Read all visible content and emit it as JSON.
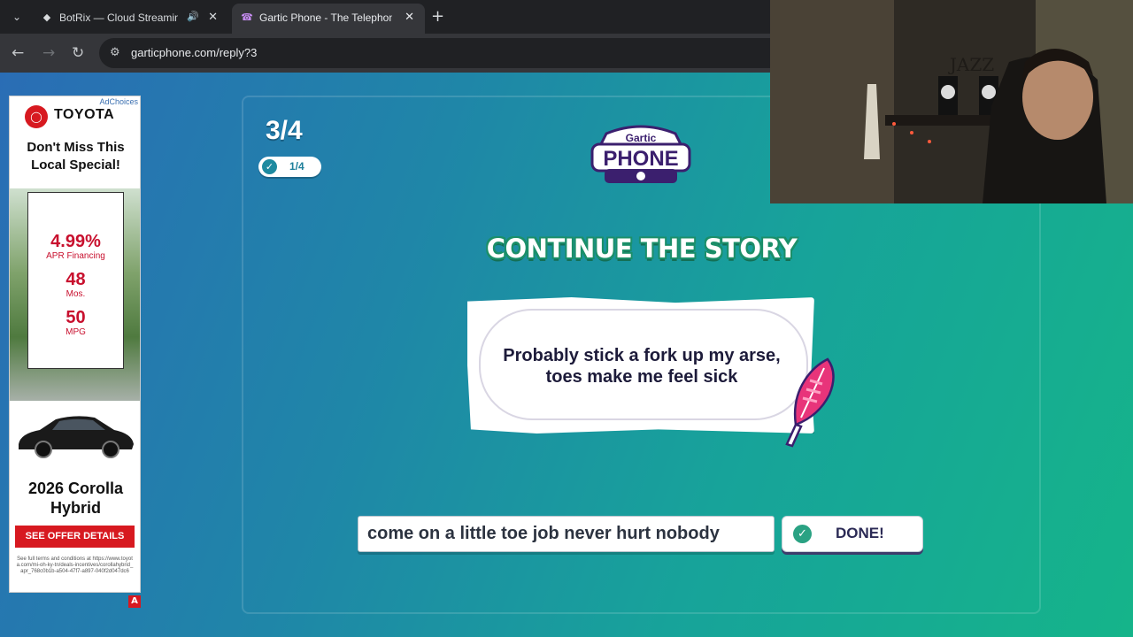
{
  "browser": {
    "tabs": [
      {
        "title": "BotRix — Cloud Streaming",
        "icon": "diamond-icon",
        "audio": true
      },
      {
        "title": "Gartic Phone - The Telephone Game",
        "icon": "phone-icon",
        "active": true
      }
    ],
    "url": "garticphone.com/reply?3"
  },
  "ad": {
    "adchoices": "AdChoices",
    "brand": "TOYOTA",
    "headline": "Don't Miss This Local Special!",
    "offers": [
      {
        "value": "4.99%",
        "label": "APR Financing"
      },
      {
        "value": "48",
        "label": "Mos."
      },
      {
        "value": "50",
        "label": "MPG"
      }
    ],
    "model": "2026 Corolla Hybrid",
    "cta": "SEE OFFER DETAILS",
    "fine_print": "See full terms and conditions at https://www.toyota.com/mi-oh-ky-tn/deals-incentives/corollahybrid_apr_768c0b1b-a504-47f7-a897-040f2d047dc6",
    "badge": "A"
  },
  "game": {
    "round": "3/4",
    "progress": "1/4",
    "logo_top": "Gartic",
    "logo_bottom": "PHONE",
    "heading": "CONTINUE THE STORY",
    "prompt": "Probably stick a fork up my arse, toes make me feel sick",
    "answer": "come on a little toe job never hurt nobody",
    "done_label": "DONE!"
  },
  "webcam": {
    "sign": "JAZZ"
  },
  "colors": {
    "accent": "#2aa283",
    "heading_outline": "#1b8f69",
    "ad_red": "#d71920",
    "text_dark": "#1d1b3a"
  }
}
